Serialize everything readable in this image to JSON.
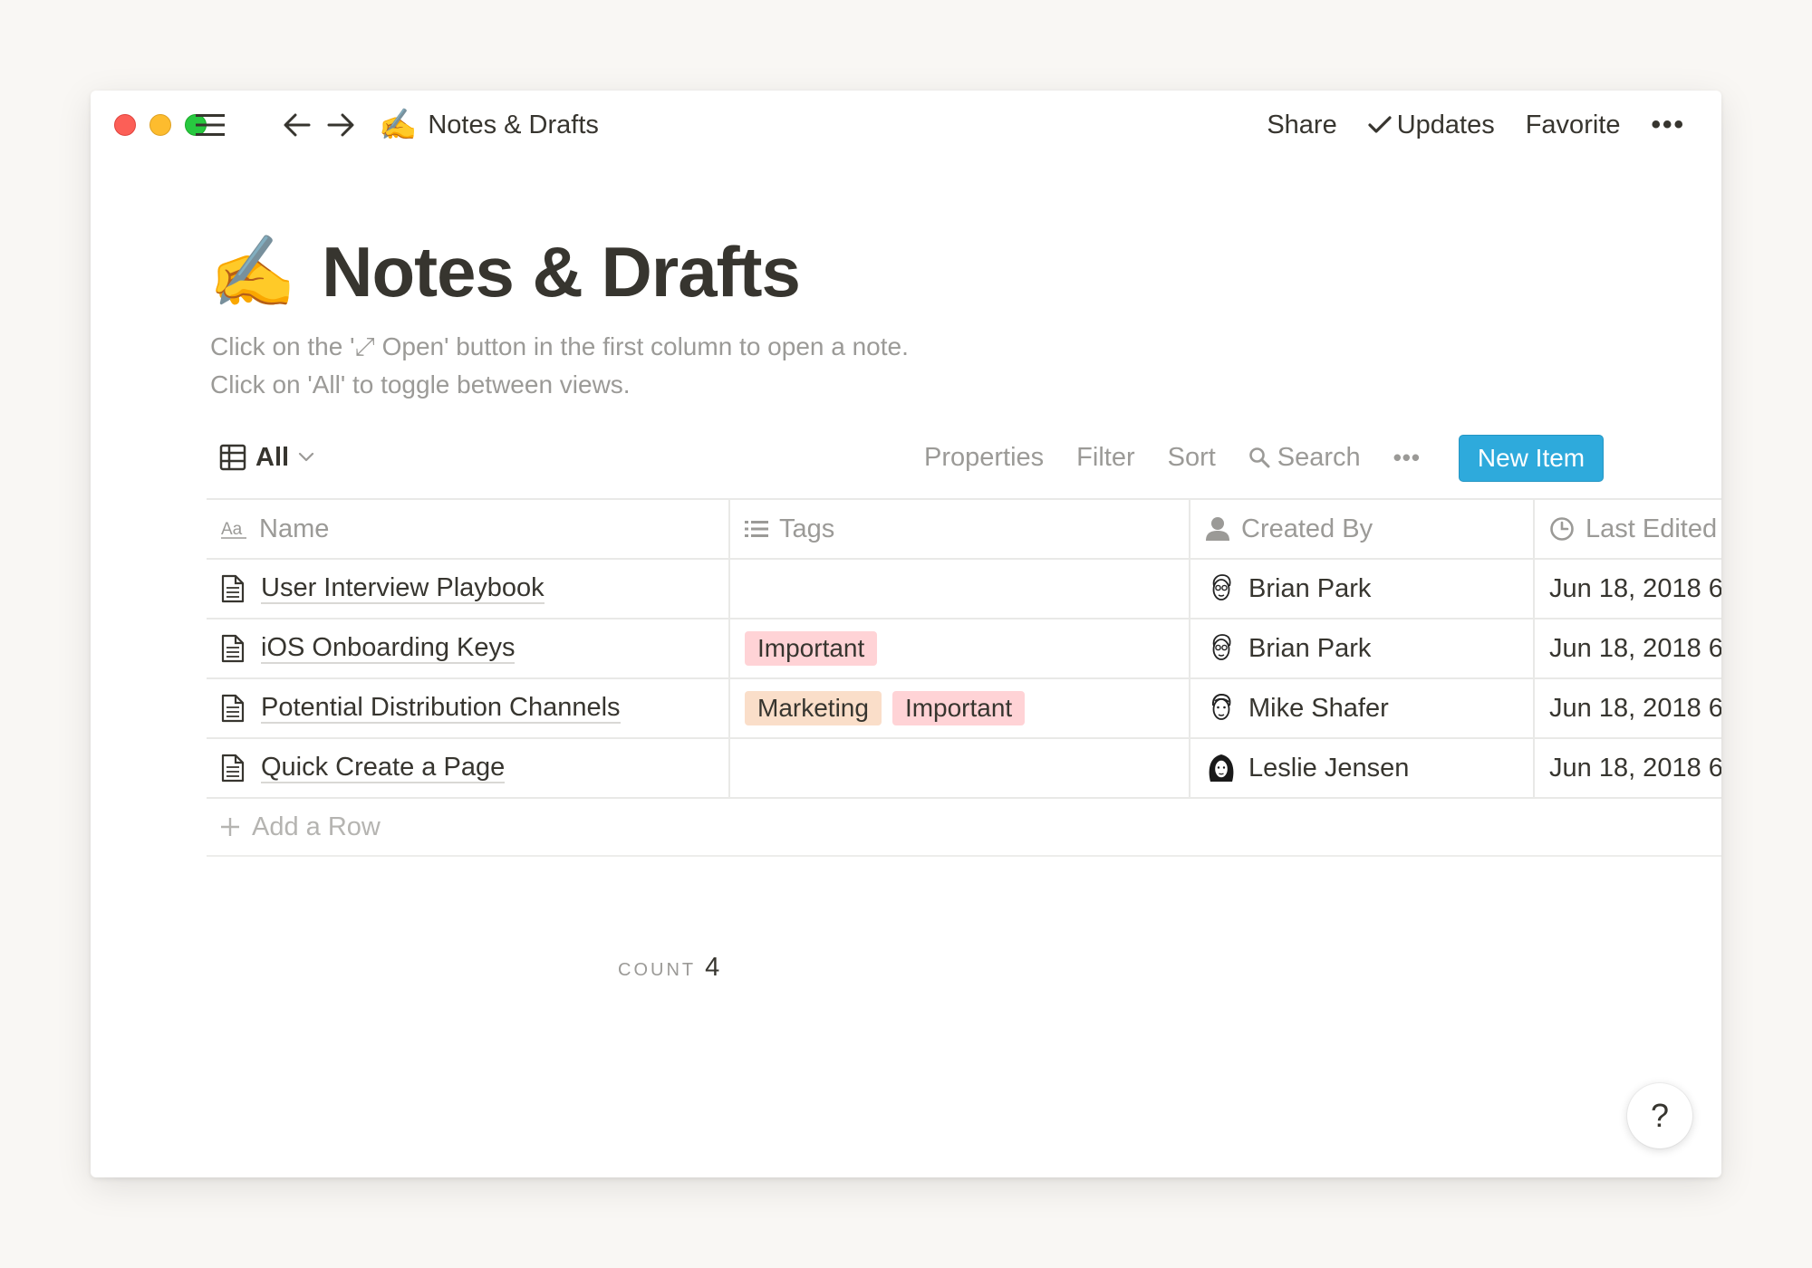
{
  "titlebar": {
    "breadcrumb_emoji": "✍️",
    "breadcrumb_title": "Notes & Drafts",
    "share_label": "Share",
    "updates_label": "Updates",
    "favorite_label": "Favorite",
    "more_label": "•••"
  },
  "page": {
    "emoji": "✍️",
    "title": "Notes & Drafts",
    "description_line1": "Click on the '⤢ Open' button in the first column to open a note.",
    "description_line2": "Click on 'All' to toggle between views."
  },
  "toolbar": {
    "view_label": "All",
    "properties_label": "Properties",
    "filter_label": "Filter",
    "sort_label": "Sort",
    "search_label": "Search",
    "more_label": "•••",
    "new_item_label": "New Item"
  },
  "table": {
    "columns": [
      {
        "label": "Name",
        "icon": "text-property-icon"
      },
      {
        "label": "Tags",
        "icon": "list-property-icon"
      },
      {
        "label": "Created By",
        "icon": "person-property-icon"
      },
      {
        "label": "Last Edited",
        "icon": "clock-property-icon"
      }
    ],
    "rows": [
      {
        "name": "User Interview Playbook",
        "tags": [],
        "created_by": "Brian Park",
        "avatar": "man-glasses-avatar",
        "last_edited": "Jun 18, 2018 6"
      },
      {
        "name": "iOS Onboarding Keys",
        "tags": [
          {
            "label": "Important",
            "color": "#ffd3d6"
          }
        ],
        "created_by": "Brian Park",
        "avatar": "man-glasses-avatar",
        "last_edited": "Jun 18, 2018 6"
      },
      {
        "name": "Potential Distribution Channels",
        "tags": [
          {
            "label": "Marketing",
            "color": "#fadec9"
          },
          {
            "label": "Important",
            "color": "#ffd3d6"
          }
        ],
        "created_by": "Mike Shafer",
        "avatar": "man-avatar",
        "last_edited": "Jun 18, 2018 6"
      },
      {
        "name": "Quick Create a Page",
        "tags": [],
        "created_by": "Leslie Jensen",
        "avatar": "woman-avatar",
        "last_edited": "Jun 18, 2018 6"
      }
    ],
    "add_row_label": "Add a Row",
    "count_label": "COUNT",
    "count_value": "4"
  },
  "help": {
    "label": "?"
  },
  "colors": {
    "accent": "#2eaadc",
    "tag_important": "#ffd3d6",
    "tag_marketing": "#fadec9",
    "muted_text": "#9b9a97",
    "text": "#37352f"
  }
}
